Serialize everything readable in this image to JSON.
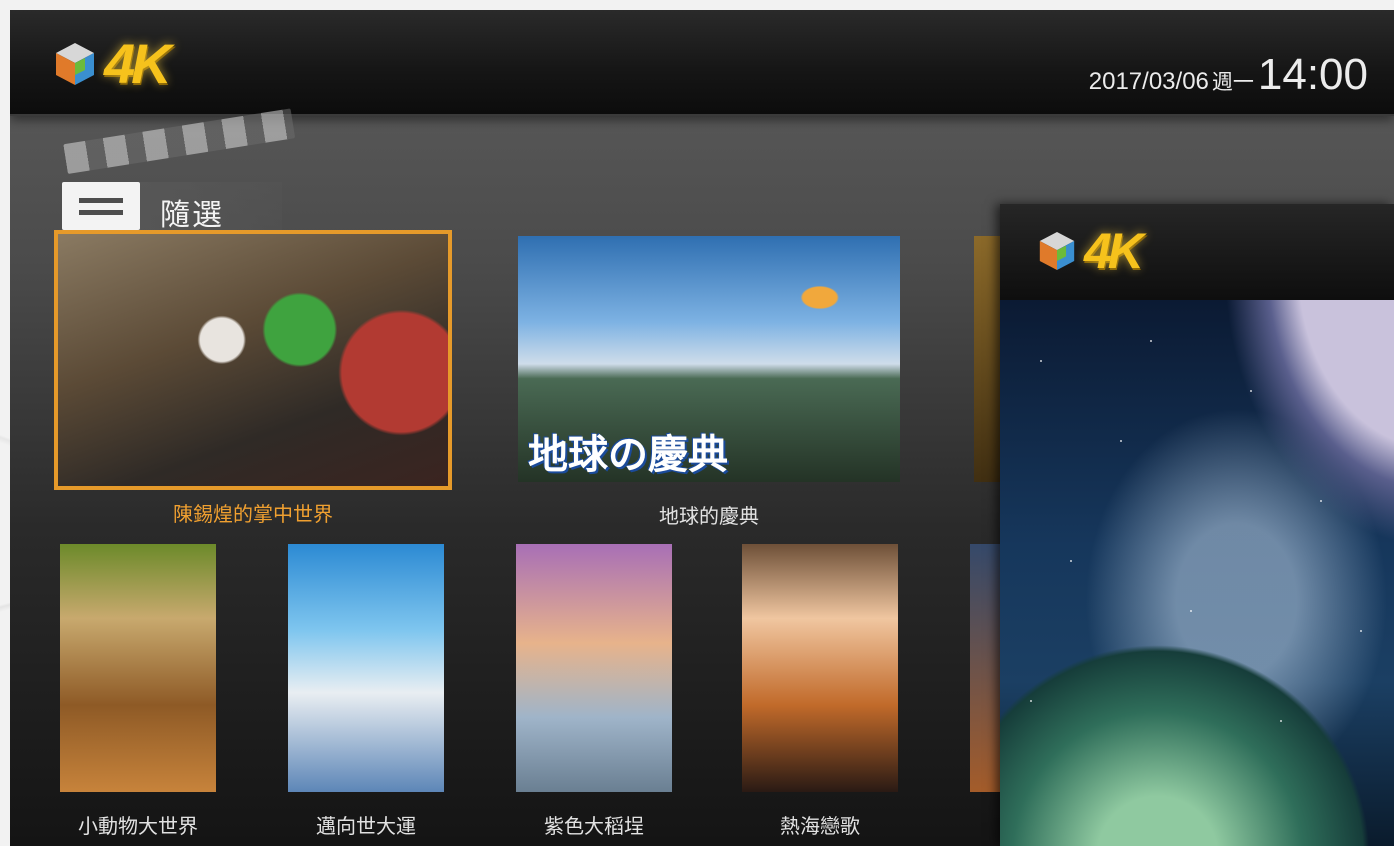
{
  "header": {
    "logo_text": "4K",
    "date": "2017/03/06",
    "weekday": "週一",
    "time": "14:00"
  },
  "section": {
    "title": "隨選"
  },
  "featured": [
    {
      "title": "陳錫煌的掌中世界",
      "selected": true,
      "thumb_text": ""
    },
    {
      "title": "地球的慶典",
      "selected": false,
      "thumb_text": "地球の慶典"
    },
    {
      "title": "",
      "selected": false,
      "thumb_text": ""
    }
  ],
  "posters": [
    {
      "title": "小動物大世界"
    },
    {
      "title": "邁向世大運"
    },
    {
      "title": "紫色大稻埕"
    },
    {
      "title": "熱海戀歌"
    },
    {
      "title": ""
    }
  ],
  "popup": {
    "logo_text": "4K"
  }
}
